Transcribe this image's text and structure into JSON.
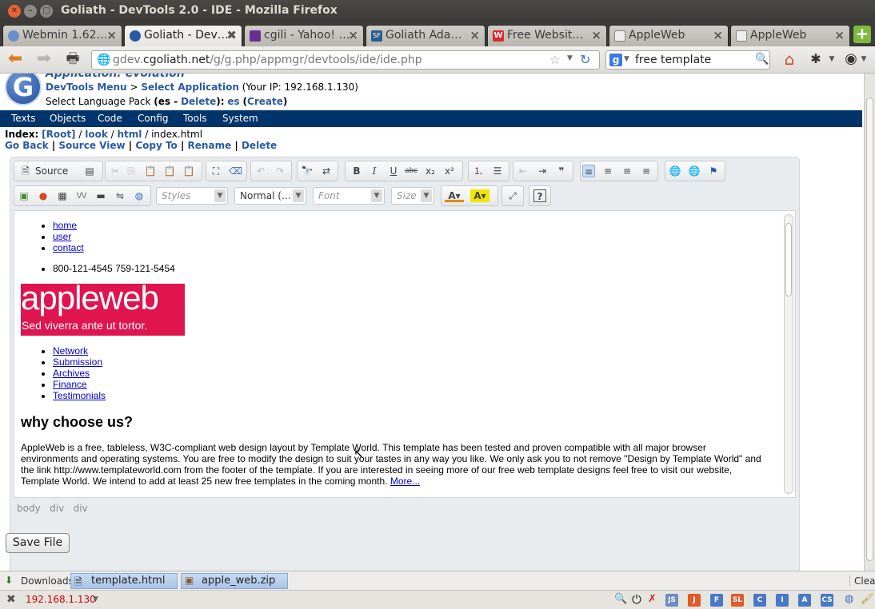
{
  "window": {
    "title": "Goliath - DevTools 2.0 - IDE - Mozilla Firefox"
  },
  "tabs": [
    {
      "label": "Webmin 1.62…"
    },
    {
      "label": "Goliath - Dev…"
    },
    {
      "label": "cgili - Yahoo! …"
    },
    {
      "label": "Goliath Ada…"
    },
    {
      "label": "Free Websit…"
    },
    {
      "label": "AppleWeb"
    },
    {
      "label": "AppleWeb"
    }
  ],
  "nav": {
    "url_prefix": "gdev.",
    "url_host": "cgoliath.net",
    "url_path": "/g/g.php/appmgr/devtools/ide/ide.php",
    "search_value": "free template"
  },
  "app": {
    "app_title": "Application: evolution",
    "devtools_menu": "DevTools Menu",
    "sep_gt": ">",
    "select_application": "Select Application",
    "ip_text": "(Your IP: 192.168.1.130)",
    "lang_label": "Select Language Pack",
    "lang_es_paren": "(es -",
    "lang_delete": "Delete",
    "lang_close": "):",
    "lang_es": "es",
    "lang_create": "Create",
    "menu": [
      "Texts",
      "Objects",
      "Code",
      "Config",
      "Tools",
      "System"
    ],
    "index_label": "Index:",
    "index_root": "[Root]",
    "index_look": "look",
    "index_html": "html",
    "index_file": "index.html",
    "actions": [
      "Go Back",
      "Source View",
      "Copy To",
      "Rename",
      "Delete"
    ]
  },
  "editor": {
    "source_label": "Source",
    "styles_placeholder": "Styles",
    "format_value": "Normal (…",
    "font_placeholder": "Font",
    "size_placeholder": "Size",
    "content": {
      "top_links": [
        "home",
        "user",
        "contact"
      ],
      "phones": "800-121-4545 759-121-5454",
      "banner_title": "appleweb",
      "banner_sub": "Sed viverra ante ut tortor.",
      "nav_links": [
        "Network",
        "Submission",
        "Archives",
        "Finance",
        "Testimonials"
      ],
      "heading": "why choose us?",
      "para_line1": "AppleWeb is a free, tableless, W3C-compliant web design layout by Template World. This template has been tested and proven compatible with all major browser",
      "para_line2": "environments and operating systems. You are free to modify the design to suit your tastes in any way you like. We only ask you to not remove \"Design by Template World\" and",
      "para_line3": "the link http://www.templateworld.com from the footer of the template. If you are interested in seeing more of our free web template designs feel free to visit our website,",
      "para_line4": "Template World. We intend to add at least 25 new free templates in the coming month.",
      "more_link": "More..."
    },
    "path": [
      "body",
      "div",
      "div"
    ]
  },
  "save_button": "Save File",
  "downloads": {
    "label": "Downloads",
    "items": [
      "template.html",
      "apple_web.zip"
    ],
    "clear": "Clear"
  },
  "status": {
    "ip": "192.168.1.130",
    "addons": [
      "JS",
      "J",
      "F",
      "SL",
      "C",
      "I",
      "A",
      "CS"
    ]
  }
}
